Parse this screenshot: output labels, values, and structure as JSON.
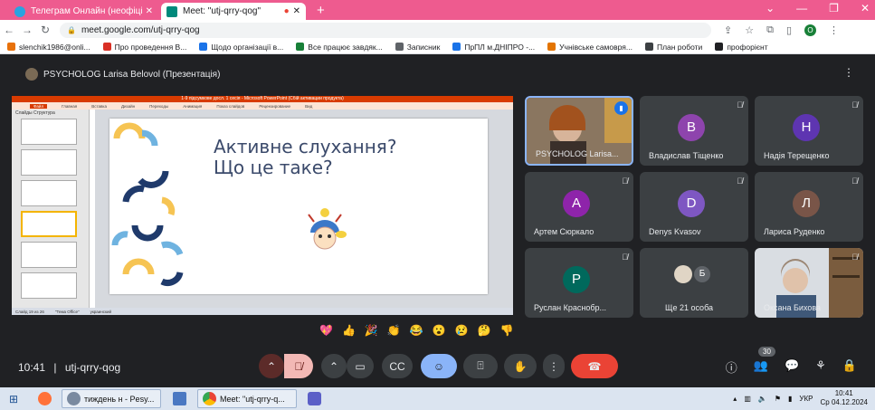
{
  "browser": {
    "tabs": [
      {
        "title": "Телеграм Онлайн (неофіційна",
        "active": false
      },
      {
        "title": "Meet: \"utj-qrry-qog\"",
        "active": true
      }
    ],
    "new_tab": "+",
    "window_controls": [
      "⌄",
      "—",
      "❐",
      "✕"
    ],
    "url": "meet.google.com/utj-qrry-qog",
    "profile_initial": "O"
  },
  "bookmarks": [
    {
      "label": "slenchik1986@onli...",
      "color": "#e8710a"
    },
    {
      "label": "Про проведення В...",
      "color": "#d93025"
    },
    {
      "label": "Щодо організації в...",
      "color": "#1a73e8"
    },
    {
      "label": "Все працює завдяк...",
      "color": "#188038"
    },
    {
      "label": "Записник",
      "color": "#5f6368"
    },
    {
      "label": "ПрПЛ м.ДНІПРО -...",
      "color": "#1a73e8"
    },
    {
      "label": "Учнівське самовря...",
      "color": "#e37400"
    },
    {
      "label": "План роботи",
      "color": "#3c4043"
    },
    {
      "label": "профорієнт",
      "color": "#202124"
    }
  ],
  "meet": {
    "presenter_label": "PSYCHOLOG Larisa Belovol (Презентація)",
    "slide": {
      "window_title": "1-9 підсумкове досл. 1 сесія - Microsoft PowerPoint (Сбій активации продукта)",
      "ribbon": [
        "Файл",
        "Главная",
        "Вставка",
        "Дизайн",
        "Переходы",
        "Анимация",
        "Показ слайдов",
        "Рецензирование",
        "Вид"
      ],
      "thumb_tabs": "Слайды  Структура",
      "title_line1": "Активне слухання?",
      "title_line2": "Що це таке?",
      "status": [
        "Слайд 19 из 26",
        "\"Тема Office\"",
        "украинский"
      ]
    },
    "participants": [
      {
        "name": "PSYCHOLOG Larisa...",
        "camera": true,
        "speaking": true
      },
      {
        "name": "Владислав Тіщенко",
        "initial": "В",
        "color": "#8e44ad",
        "muted": true
      },
      {
        "name": "Надія Терещенко",
        "initial": "Н",
        "color": "#5e35b1",
        "muted": true
      },
      {
        "name": "Артем Сюркало",
        "initial": "А",
        "color": "#8e24aa",
        "muted": true
      },
      {
        "name": "Denys Kvasov",
        "initial": "D",
        "color": "#7e57c2",
        "muted": true
      },
      {
        "name": "Лариса Руденко",
        "initial": "Л",
        "color": "#795548",
        "muted": true
      },
      {
        "name": "Руслан Краснобр...",
        "initial": "Р",
        "color": "#00695c",
        "muted": true
      },
      {
        "name": "Ще 21 особа",
        "initial": "Б",
        "color": "#5f6368",
        "muted": false
      },
      {
        "name": "Оксана Бихова",
        "camera": true,
        "muted": true
      }
    ],
    "reactions": [
      "💖",
      "👍",
      "🎉",
      "👏",
      "😂",
      "😮",
      "😢",
      "🤔",
      "👎"
    ],
    "time": "10:41",
    "separator": "|",
    "meeting_code": "utj-qrry-qog",
    "participant_count": "30"
  },
  "taskbar": {
    "apps": [
      {
        "label": "тиждень н - Pesy...",
        "color": "#7a8aa0"
      },
      {
        "label": "",
        "color": "#4a78c2"
      },
      {
        "label": "Meet: \"utj-qrry-q...",
        "color": "#ea4335"
      },
      {
        "label": "",
        "color": "#5b5fc7"
      }
    ],
    "lang": "УКР",
    "time": "10:41",
    "date": "Ср 04.12.2024"
  }
}
